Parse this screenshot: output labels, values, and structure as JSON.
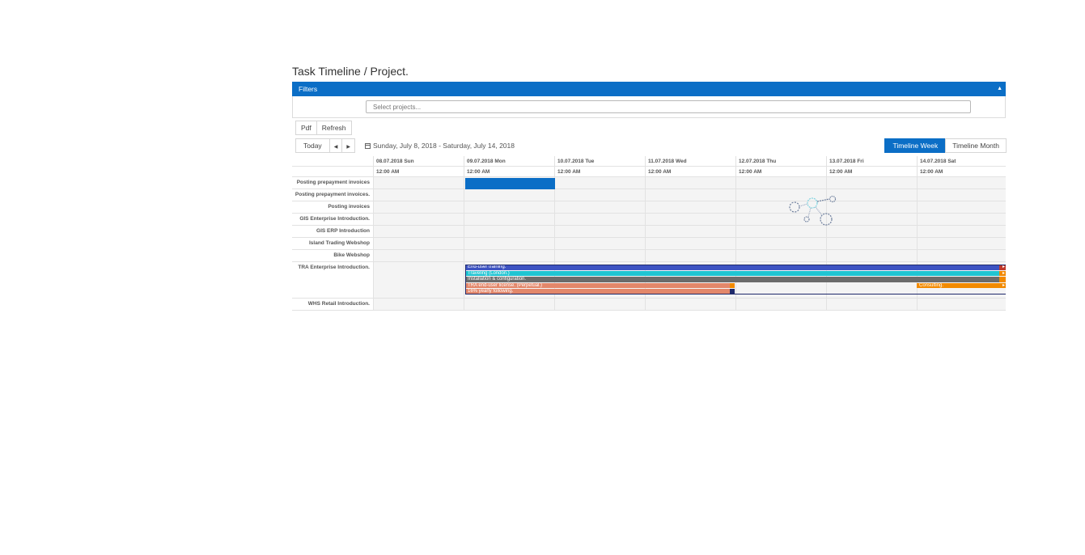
{
  "page": {
    "title": "Task Timeline / Project."
  },
  "filters": {
    "label": "Filters",
    "toggle_icon": "caret-up-icon",
    "project_select_placeholder": "Select projects..."
  },
  "export": {
    "pdf_label": "Pdf",
    "refresh_label": "Refresh"
  },
  "nav": {
    "today_label": "Today",
    "prev_icon": "caret-left-icon",
    "next_icon": "caret-right-icon",
    "date_range": "Sunday, July 8, 2018 - Saturday, July 14, 2018",
    "calendar_icon": "calendar-icon"
  },
  "views": [
    {
      "label": "Timeline Week",
      "active": true
    },
    {
      "label": "Timeline Month",
      "active": false
    }
  ],
  "columns": [
    {
      "date": "08.07.2018 Sun",
      "time": "12:00 AM"
    },
    {
      "date": "09.07.2018 Mon",
      "time": "12:00 AM"
    },
    {
      "date": "10.07.2018 Tue",
      "time": "12:00 AM"
    },
    {
      "date": "11.07.2018 Wed",
      "time": "12:00 AM"
    },
    {
      "date": "12.07.2018 Thu",
      "time": "12:00 AM"
    },
    {
      "date": "13.07.2018 Fri",
      "time": "12:00 AM"
    },
    {
      "date": "14.07.2018 Sat",
      "time": "12:00 AM"
    }
  ],
  "resources": [
    "Posting prepayment invoices",
    "Posting prepayment invoices.",
    "Posting invoices",
    "GIS Enterprise Introduction.",
    "GIS ERP Introduction",
    "Island Trading Webshop",
    "Bike Webshop",
    "TRA Enterprise Introduction.",
    "WHS Retail Introduction."
  ],
  "events": [
    {
      "label": "",
      "color": "#0b6ec6"
    },
    {
      "label": "End-user training.",
      "color": "#3d53c2"
    },
    {
      "label": "Traveling (London.)",
      "color": "#1fc4d2"
    },
    {
      "label": "Installation & configuration.",
      "color": "#6b6b6b"
    },
    {
      "label": "TRA end-user license. (Perpetual.)",
      "color": "#e3876a"
    },
    {
      "label": "16% yearly following.",
      "color": "#e3876a"
    },
    {
      "label": "Consulting.",
      "color": "#f28a00"
    }
  ],
  "colors": {
    "accent": "#0b6ec6",
    "endcap_orange": "#f28a00",
    "endcap_red": "#c0392b",
    "endcap_navy": "#1f2a6b"
  }
}
